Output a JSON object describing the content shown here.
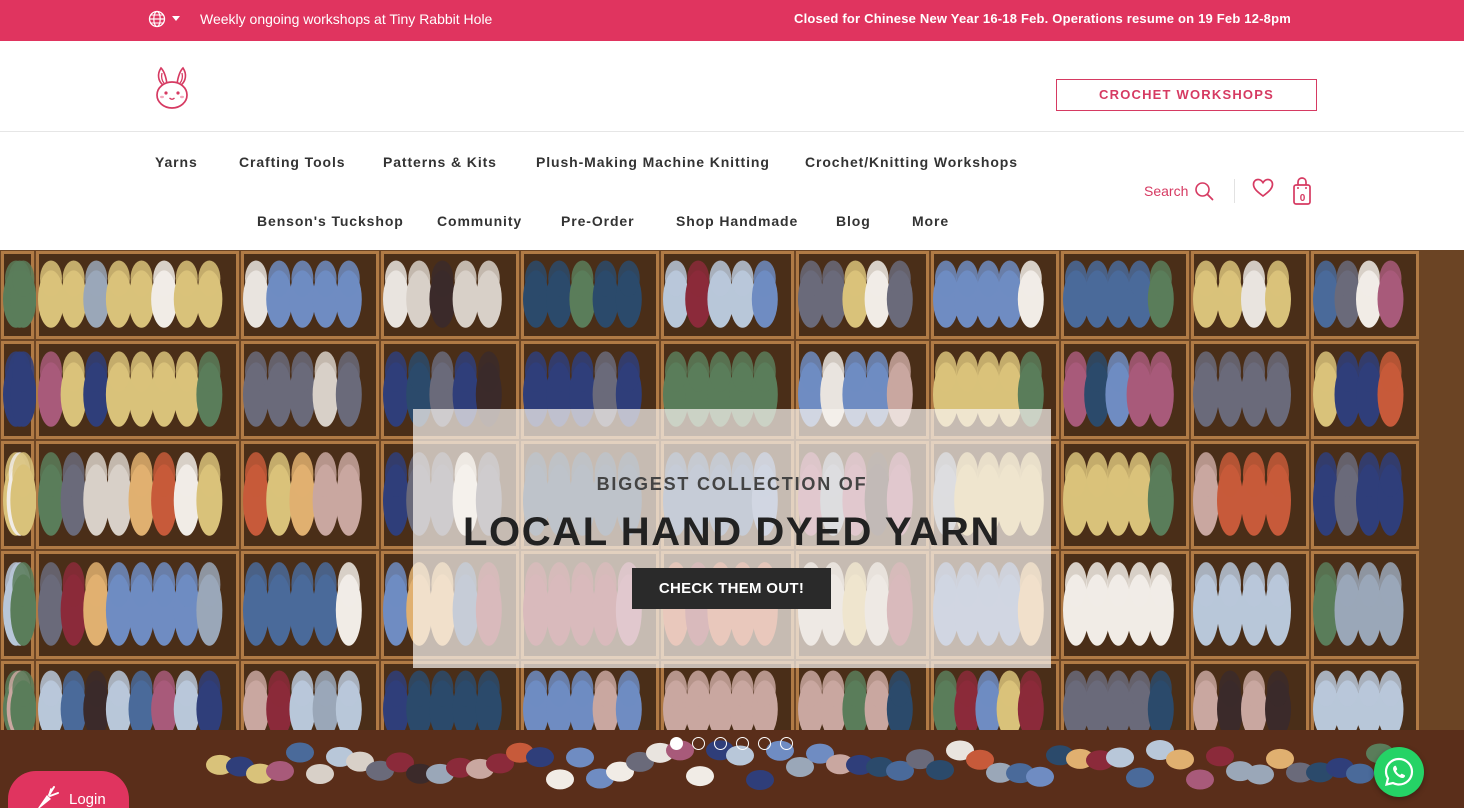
{
  "announcement": {
    "left_text": "Weekly ongoing workshops at Tiny Rabbit Hole",
    "right_text": "Closed for Chinese New Year 16-18 Feb. Operations resume on 19 Feb 12-8pm",
    "background": "#e0345f",
    "icons": [
      "globe-icon",
      "chevron-down-icon"
    ]
  },
  "header": {
    "logo_icon": "bunny-logo",
    "cta_label": "CROCHET WORKSHOPS",
    "accent": "#d63a62"
  },
  "nav": {
    "row1": [
      "Yarns",
      "Crafting Tools",
      "Patterns & Kits",
      "Plush-Making Machine Knitting",
      "Crochet/Knitting Workshops"
    ],
    "row2": [
      "Benson's Tuckshop",
      "Community",
      "Pre-Order",
      "Shop Handmade",
      "Blog",
      "More"
    ],
    "search_label": "Search",
    "cart_count": "0",
    "icons": [
      "search-icon",
      "heart-icon",
      "shopping-bag-icon"
    ]
  },
  "hero": {
    "subtitle": "BIGGEST COLLECTION OF",
    "title": "LOCAL HAND DYED YARN",
    "button_label": "CHECK THEM OUT!",
    "slide_count": 6,
    "active_slide": 1
  },
  "floating": {
    "login_label": "Login",
    "icons": [
      "carrot-icon",
      "whatsapp-icon"
    ]
  }
}
